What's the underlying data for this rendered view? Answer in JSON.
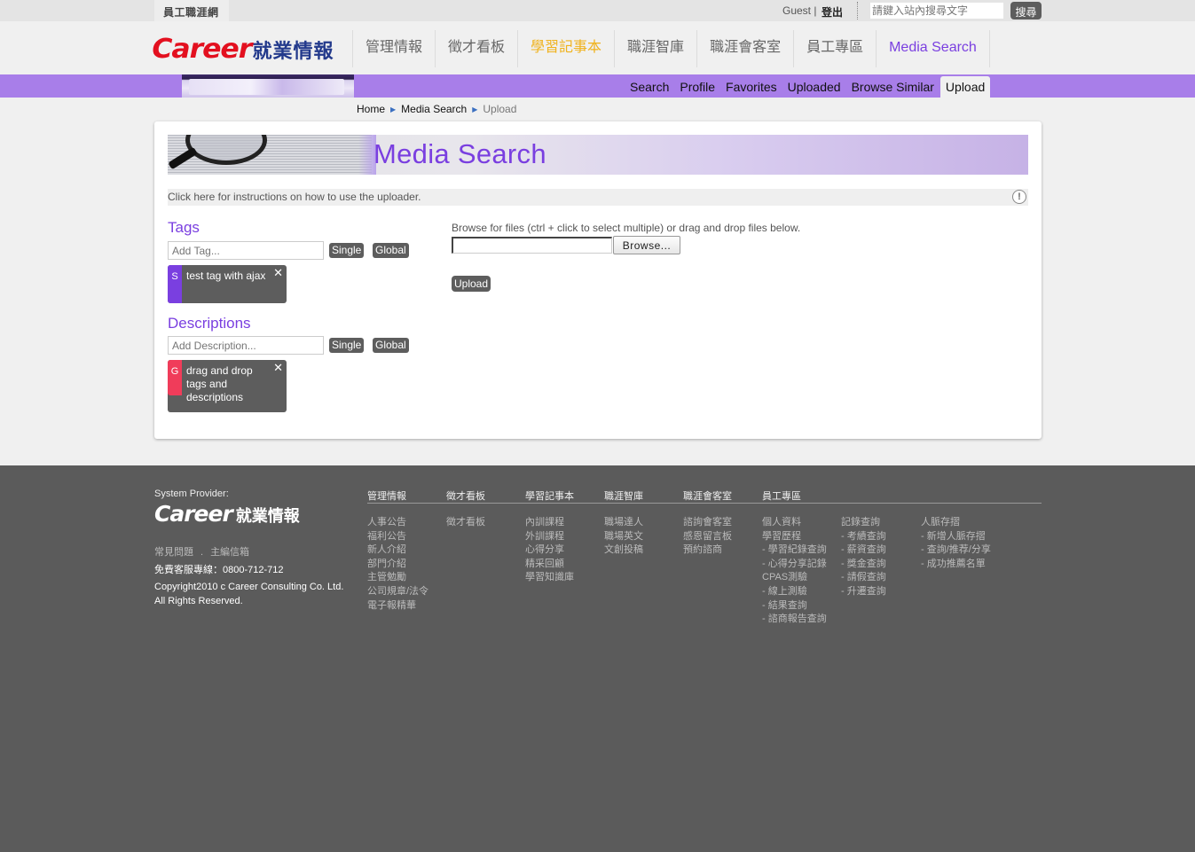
{
  "topbar": {
    "site_tab": "員工職涯網",
    "user": "Guest |",
    "logout": "登出",
    "search_placeholder": "請鍵入站內搜尋文字",
    "search_button": "搜尋"
  },
  "header": {
    "logo_en": "Career",
    "logo_cn": "就業情報",
    "nav": [
      {
        "label": "管理情報"
      },
      {
        "label": "徵才看板"
      },
      {
        "label": "學習記事本"
      },
      {
        "label": "職涯智庫"
      },
      {
        "label": "職涯會客室"
      },
      {
        "label": "員工專區"
      },
      {
        "label": "Media Search"
      }
    ]
  },
  "subnav": {
    "items": [
      {
        "label": "Search"
      },
      {
        "label": "Profile"
      },
      {
        "label": "Favorites"
      },
      {
        "label": "Uploaded"
      },
      {
        "label": "Browse Similar"
      },
      {
        "label": "Upload",
        "active": true
      }
    ]
  },
  "breadcrumb": {
    "items": [
      "Home",
      "Media Search",
      "Upload"
    ],
    "separator": "▶"
  },
  "page": {
    "title": "Media Search",
    "instructions": "Click here for instructions on how to use the uploader.",
    "alert_icon": "!"
  },
  "tags": {
    "title": "Tags",
    "placeholder": "Add Tag...",
    "single": "Single",
    "global": "Global",
    "items": [
      {
        "flag": "S",
        "text": "test tag with ajax",
        "flag_color": "#7a3fe0"
      }
    ]
  },
  "descriptions": {
    "title": "Descriptions",
    "placeholder": "Add Description...",
    "single": "Single",
    "global": "Global",
    "items": [
      {
        "flag": "G",
        "text": "drag and drop tags and descriptions",
        "flag_color": "#f03c5a"
      }
    ]
  },
  "uploader": {
    "label": "Browse for files (ctrl + click to select multiple) or drag and drop files below.",
    "browse": "Browse...",
    "upload": "Upload"
  },
  "footer": {
    "provider_label": "System Provider:",
    "logo_en": "Career",
    "logo_cn": "就業情報",
    "links": [
      "常見問題",
      "主編信箱"
    ],
    "link_sep": ".",
    "hotline": "免費客服專線：0800-712-712",
    "copyright_1": "Copyright2010 c Career Consulting Co. Ltd.",
    "copyright_2": "All Rights Reserved.",
    "columns": [
      {
        "head": "管理情報",
        "items": [
          "人事公告",
          "福利公告",
          "新人介紹",
          "部門介紹",
          "主管勉勵",
          "公司規章/法令",
          "電子報精華"
        ]
      },
      {
        "head": "徵才看板",
        "items": [
          "徵才看板"
        ]
      },
      {
        "head": "學習記事本",
        "items": [
          "內訓課程",
          "外訓課程",
          "心得分享",
          "精采回顧",
          "學習知識庫"
        ]
      },
      {
        "head": "職涯智庫",
        "items": [
          "職場達人",
          "職場英文",
          "文創投稿"
        ]
      },
      {
        "head": "職涯會客室",
        "items": [
          "諮詢會客室",
          "感恩留言板",
          "預約諮商"
        ]
      },
      {
        "head": "員工專區",
        "items": [
          "個人資料",
          "學習歷程",
          "- 學習紀錄查詢",
          "- 心得分享記錄",
          "CPAS測驗",
          "- 線上測驗",
          "- 結果查詢",
          "- 諮商報告查詢"
        ]
      },
      {
        "head": "",
        "items": [
          "記錄查詢",
          "- 考績查詢",
          "- 薪資查詢",
          "- 獎金查詢",
          "- 請假查詢",
          "- 升遷查詢"
        ]
      },
      {
        "head": "",
        "items": [
          "人脈存摺",
          "- 新增人脈存摺",
          "- 查詢/推荐/分享",
          "- 成功推薦名單"
        ]
      }
    ]
  },
  "colors": {
    "accent_purple": "#7a3fe0",
    "subnav_bar": "#a87ee9",
    "learn_gold": "#f0b21c",
    "logo_red": "#e3101f",
    "button_gray": "#5d5d5d"
  }
}
